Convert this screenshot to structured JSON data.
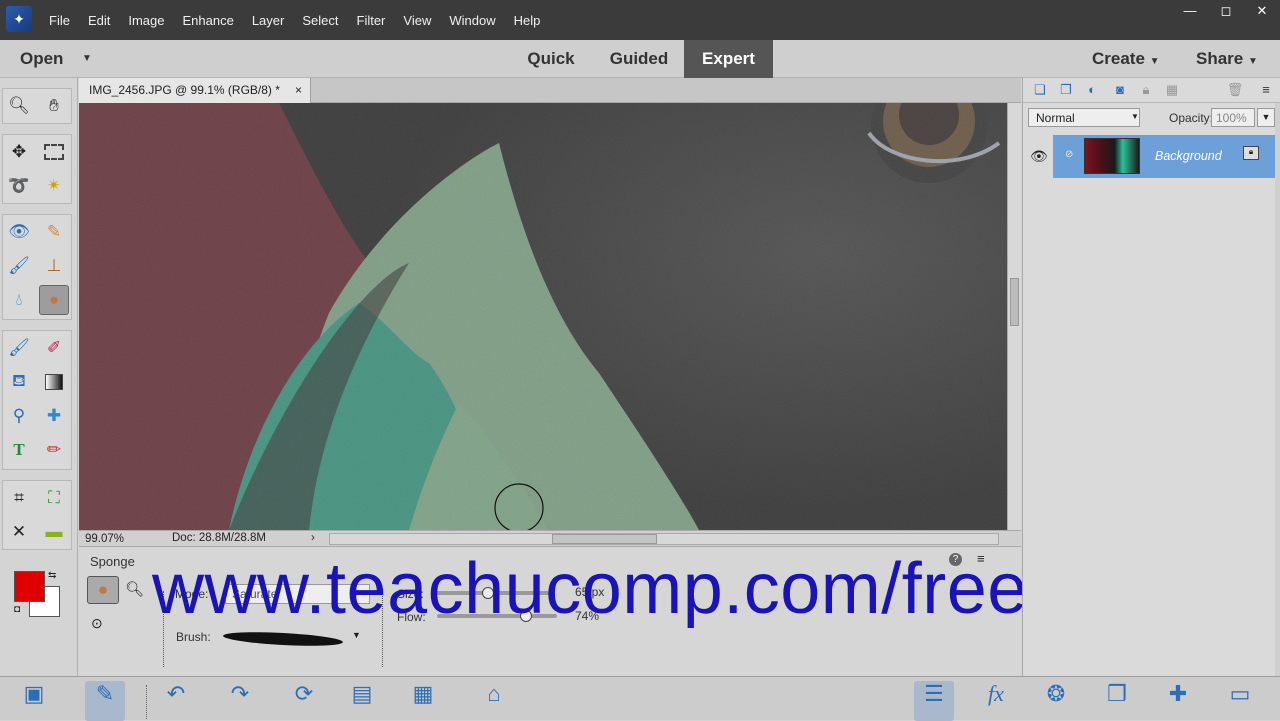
{
  "menubar": {
    "logo": "✦",
    "items": [
      "File",
      "Edit",
      "Image",
      "Enhance",
      "Layer",
      "Select",
      "Filter",
      "View",
      "Window",
      "Help"
    ],
    "controls": [
      "—",
      "◻",
      "✕"
    ]
  },
  "modebar": {
    "open_label": "Open",
    "tabs": [
      "Quick",
      "Guided",
      "Expert"
    ],
    "active_tab": "Expert",
    "create_label": "Create",
    "share_label": "Share"
  },
  "document": {
    "tab_title": "IMG_2456.JPG @ 99.1% (RGB/8) *",
    "close_glyph": "×",
    "zoom_readout": "99.07%",
    "doc_size": "Doc: 28.8M/28.8M",
    "status_arrow": "›"
  },
  "tool_options": {
    "tool_name": "Sponge",
    "mode_label": "Mode:",
    "mode_value": "Saturate",
    "size_label": "Size:",
    "size_value": "65 px",
    "size_fraction": 0.45,
    "flow_label": "Flow:",
    "flow_value": "74%",
    "flow_fraction": 0.74,
    "brush_label": "Brush:",
    "help_glyph": "?",
    "menu_glyph": "≡"
  },
  "watermark": "www.teachucomp.com/free",
  "layers": {
    "blend_mode": "Normal",
    "opacity_label": "Opacity:",
    "opacity_value": "100%",
    "layer_name": "Background"
  },
  "bottombar": {
    "buttons": [
      {
        "icon": "photo-bin-icon",
        "label": "Photo Bin"
      },
      {
        "icon": "tool-options-icon",
        "label": "Tool Options"
      },
      {
        "icon": "undo-icon",
        "label": "Undo"
      },
      {
        "icon": "redo-icon",
        "label": "Redo"
      },
      {
        "icon": "rotate-icon",
        "label": "Rotate"
      },
      {
        "icon": "layout-icon",
        "label": "Layout"
      },
      {
        "icon": "organizer-icon",
        "label": "Organizer"
      },
      {
        "icon": "home-screen-icon",
        "label": "Home Screen"
      },
      {
        "icon": "layers-icon",
        "label": "Layers"
      },
      {
        "icon": "effects-icon",
        "label": "Effects"
      },
      {
        "icon": "filters-icon",
        "label": "Filters"
      },
      {
        "icon": "styles-icon",
        "label": "Styles"
      },
      {
        "icon": "graphics-icon",
        "label": "Graphics"
      },
      {
        "icon": "more-icon",
        "label": "More"
      }
    ]
  },
  "colors": {
    "foreground": "#e00000",
    "background": "#ffffff",
    "accent": "#2a6db8",
    "watermark": "#1a14b8"
  }
}
